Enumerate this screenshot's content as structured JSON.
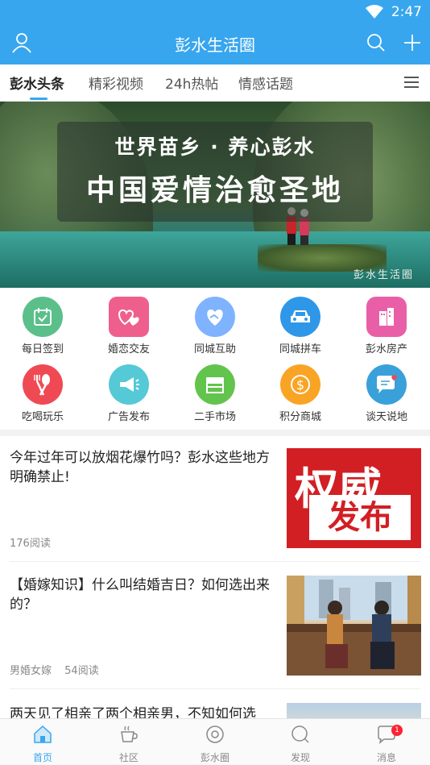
{
  "status": {
    "time": "2:47"
  },
  "appbar": {
    "title": "彭水生活圈"
  },
  "tabs": [
    {
      "label": "彭水头条",
      "active": true
    },
    {
      "label": "精彩视频"
    },
    {
      "label": "24h热帖"
    },
    {
      "label": "情感话题"
    }
  ],
  "banner": {
    "line1": "世界苗乡 · 养心彭水",
    "line2": "中国爱情治愈圣地",
    "watermark": "彭水生活圈"
  },
  "grid": [
    {
      "label": "每日签到",
      "color": "#5bbf8a",
      "icon": "calendar-check-icon"
    },
    {
      "label": "婚恋交友",
      "color": "#ef5f8d",
      "icon": "hearts-icon"
    },
    {
      "label": "同城互助",
      "color": "#7fb3ff",
      "icon": "handshake-heart-icon"
    },
    {
      "label": "同城拼车",
      "color": "#2f97e8",
      "icon": "car-icon"
    },
    {
      "label": "彭水房产",
      "color": "#e95fa7",
      "icon": "building-icon"
    },
    {
      "label": "吃喝玩乐",
      "color": "#ef4a54",
      "icon": "fork-spoon-icon"
    },
    {
      "label": "广告发布",
      "color": "#55c9d5",
      "icon": "megaphone-icon"
    },
    {
      "label": "二手市场",
      "color": "#62c44d",
      "icon": "shop-icon"
    },
    {
      "label": "积分商城",
      "color": "#f9a425",
      "icon": "coin-icon"
    },
    {
      "label": "谈天说地",
      "color": "#3aa0d9",
      "icon": "chat-heart-icon"
    }
  ],
  "articles": [
    {
      "title": "今年过年可以放烟花爆竹吗？彭水这些地方明确禁止!",
      "tag": "",
      "reads": "176阅读",
      "image": "red-authority",
      "img_text1": "权威",
      "img_text2": "发布"
    },
    {
      "title": "【婚嫁知识】什么叫结婚吉日？如何选出来的？",
      "tag": "男婚女嫁",
      "reads": "54阅读",
      "image": "couple-photo"
    },
    {
      "title": "两天见了相亲了两个相亲男，不知如何选",
      "tag": "",
      "reads": "",
      "image": "photo"
    }
  ],
  "bottomnav": [
    {
      "label": "首页",
      "active": true,
      "icon": "home-icon"
    },
    {
      "label": "社区",
      "icon": "cup-icon"
    },
    {
      "label": "彭水圈",
      "icon": "circle-icon"
    },
    {
      "label": "发现",
      "icon": "compass-icon"
    },
    {
      "label": "消息",
      "icon": "message-icon",
      "badge": "1"
    }
  ]
}
